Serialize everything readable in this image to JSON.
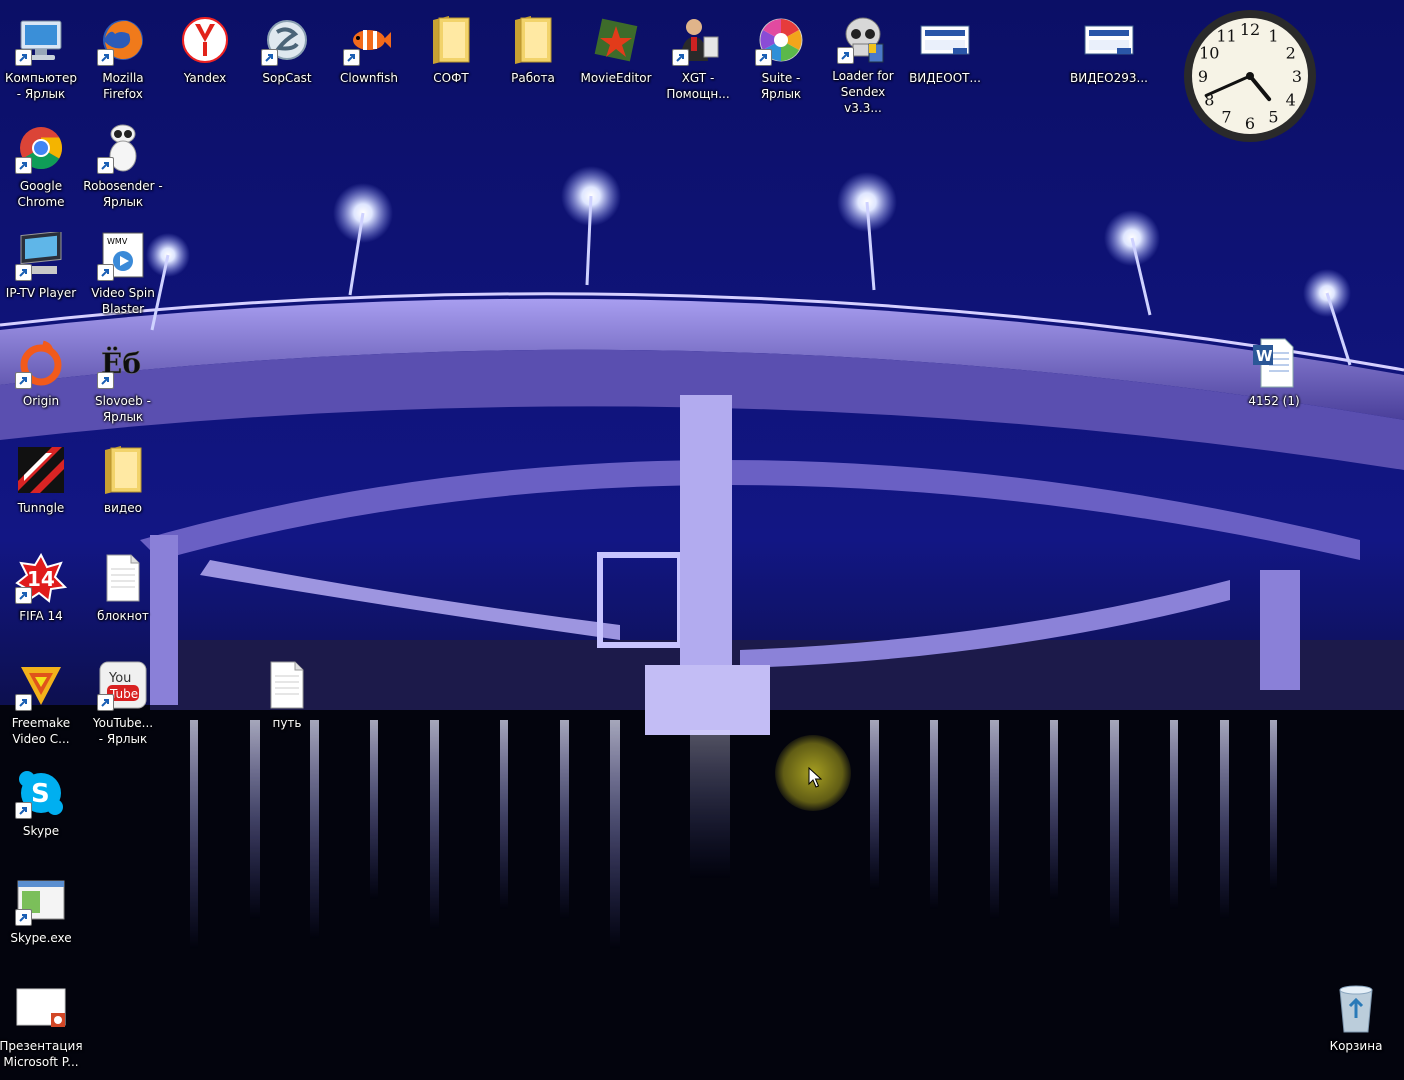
{
  "desktop": {
    "icons": [
      {
        "key": "computer",
        "label": "Компьютер\n- Ярлык",
        "icon": "computer-icon",
        "shortcut": true
      },
      {
        "key": "firefox",
        "label": "Mozilla\nFirefox",
        "icon": "firefox-icon",
        "shortcut": true
      },
      {
        "key": "yandex",
        "label": "Yandex",
        "icon": "yandex-icon",
        "shortcut": false
      },
      {
        "key": "sopcast",
        "label": "SopCast",
        "icon": "sopcast-icon",
        "shortcut": true
      },
      {
        "key": "clownfish",
        "label": "Clownfish",
        "icon": "clownfish-icon",
        "shortcut": true
      },
      {
        "key": "soft",
        "label": "СОФТ",
        "icon": "folder-icon",
        "shortcut": false
      },
      {
        "key": "rabota",
        "label": "Работа",
        "icon": "folder-icon",
        "shortcut": false
      },
      {
        "key": "movieeditor",
        "label": "MovieEditor",
        "icon": "movieeditor-icon",
        "shortcut": false
      },
      {
        "key": "xgt",
        "label": "XGT -\nПомощн...",
        "icon": "assistant-icon",
        "shortcut": true
      },
      {
        "key": "suite",
        "label": "Suite -\nЯрлык",
        "icon": "suite-icon",
        "shortcut": true
      },
      {
        "key": "loader",
        "label": "Loader for\nSendex v3.3...",
        "icon": "skull-icon",
        "shortcut": true
      },
      {
        "key": "videoot",
        "label": "ВИДЕООТ...",
        "icon": "video-file-icon",
        "shortcut": false
      },
      {
        "key": "video293",
        "label": "ВИДЕО293...",
        "icon": "video-file-icon",
        "shortcut": false
      },
      {
        "key": "chrome",
        "label": "Google\nChrome",
        "icon": "chrome-icon",
        "shortcut": true
      },
      {
        "key": "robosender",
        "label": "Robosender -\nЯрлык",
        "icon": "robot-icon",
        "shortcut": true
      },
      {
        "key": "iptv",
        "label": "IP-TV Player",
        "icon": "tv-icon",
        "shortcut": true
      },
      {
        "key": "videospin",
        "label": "Video Spin\nBlaster",
        "icon": "wmv-icon",
        "shortcut": true
      },
      {
        "key": "origin",
        "label": "Origin",
        "icon": "origin-icon",
        "shortcut": true
      },
      {
        "key": "slovoeb",
        "label": "Slovoeb -\nЯрлык",
        "icon": "slovoeb-icon",
        "shortcut": true
      },
      {
        "key": "tunngle",
        "label": "Tunngle",
        "icon": "tunngle-icon",
        "shortcut": false
      },
      {
        "key": "video",
        "label": "видео",
        "icon": "folder-icon",
        "shortcut": false
      },
      {
        "key": "fifa",
        "label": "FIFA 14",
        "icon": "fifa-icon",
        "shortcut": true
      },
      {
        "key": "bloknot",
        "label": "блокнот",
        "icon": "text-file-icon",
        "shortcut": false
      },
      {
        "key": "put",
        "label": "путь",
        "icon": "text-file-icon",
        "shortcut": false
      },
      {
        "key": "freemake",
        "label": "Freemake\nVideo C...",
        "icon": "freemake-icon",
        "shortcut": true
      },
      {
        "key": "youtube",
        "label": "YouTube...\n- Ярлык",
        "icon": "youtube-icon",
        "shortcut": true
      },
      {
        "key": "skype",
        "label": "Skype",
        "icon": "skype-icon",
        "shortcut": true
      },
      {
        "key": "skypeexe",
        "label": "Skype.exe",
        "icon": "window-icon",
        "shortcut": true
      },
      {
        "key": "presentation",
        "label": "Презентация\nMicrosoft P...",
        "icon": "powerpoint-icon",
        "shortcut": false
      },
      {
        "key": "word4152",
        "label": "4152 (1)",
        "icon": "word-icon",
        "shortcut": false
      },
      {
        "key": "recycle",
        "label": "Корзина",
        "icon": "recycle-bin-icon",
        "shortcut": false
      }
    ]
  },
  "clock": {
    "hour": 4,
    "minute": 41,
    "numbers": [
      "12",
      "1",
      "2",
      "3",
      "4",
      "5",
      "6",
      "7",
      "8",
      "9",
      "10",
      "11"
    ]
  },
  "colors": {
    "sky": "#0a0e5e",
    "bridge": "#7a6fd0",
    "water": "#03040c",
    "folder": "#f2d36b"
  }
}
